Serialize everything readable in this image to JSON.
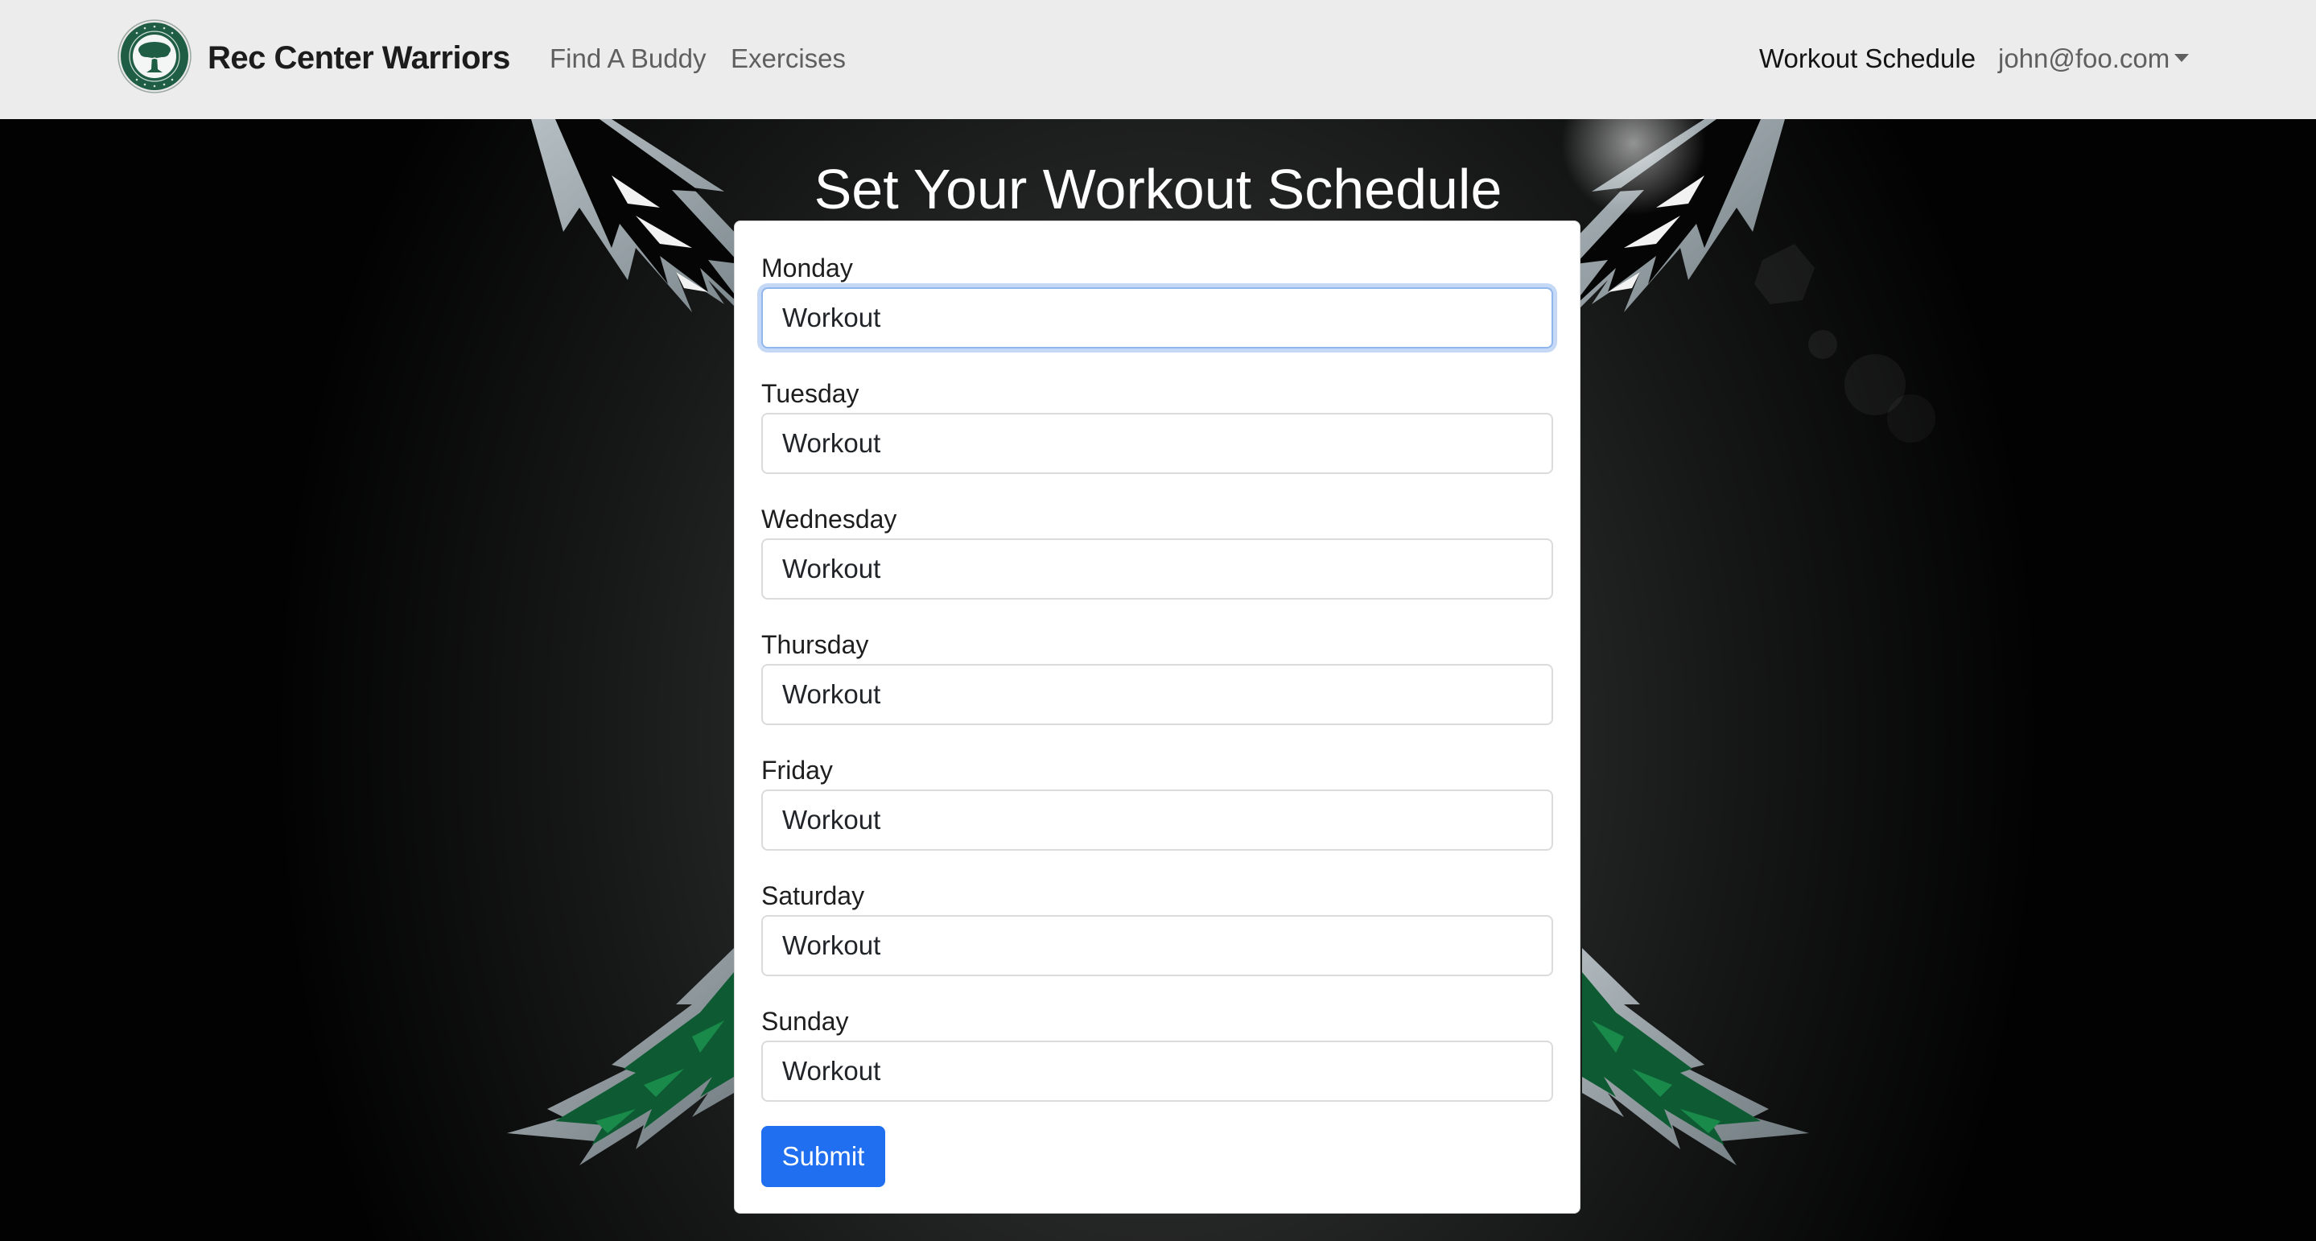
{
  "navbar": {
    "brand_name": "Rec Center Warriors",
    "logo_icon": "campus-center-tree-logo-icon",
    "links": [
      {
        "label": "Find A Buddy"
      },
      {
        "label": "Exercises"
      }
    ],
    "right_links": [
      {
        "label": "Workout Schedule",
        "active": true
      },
      {
        "label": "john@foo.com",
        "dropdown": true
      }
    ]
  },
  "main": {
    "title": "Set Your Workout Schedule",
    "fields": [
      {
        "label": "Monday",
        "value": "Workout",
        "focused": true
      },
      {
        "label": "Tuesday",
        "value": "Workout"
      },
      {
        "label": "Wednesday",
        "value": "Workout"
      },
      {
        "label": "Thursday",
        "value": "Workout"
      },
      {
        "label": "Friday",
        "value": "Workout"
      },
      {
        "label": "Saturday",
        "value": "Workout"
      },
      {
        "label": "Sunday",
        "value": "Workout"
      }
    ],
    "submit_label": "Submit"
  },
  "colors": {
    "navbar_bg": "#ececec",
    "primary": "#1f6ff0",
    "focus_ring": "#c5d8f6",
    "brand_green": "#0f5b36"
  }
}
